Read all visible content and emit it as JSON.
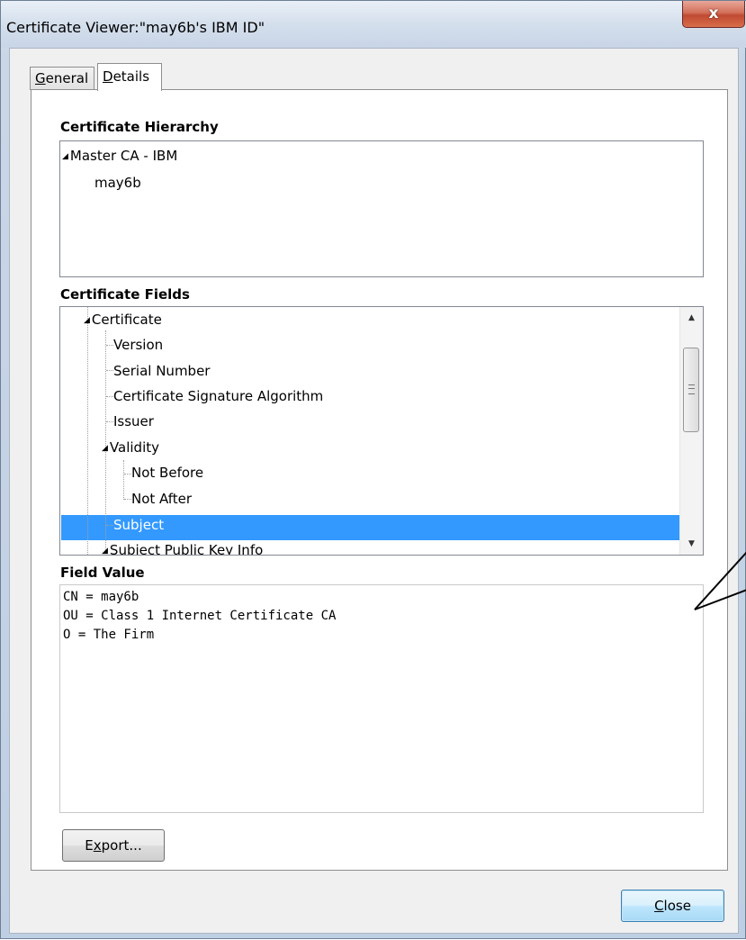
{
  "window": {
    "title": "Certificate Viewer:\"may6b's IBM ID\"",
    "close_label": "x"
  },
  "tabs": [
    {
      "label_u": "G",
      "label_rest": "eneral"
    },
    {
      "label_u": "D",
      "label_rest": "etails"
    }
  ],
  "hierarchy": {
    "label": "Certificate Hierarchy",
    "items": [
      "Master CA - IBM",
      "may6b"
    ]
  },
  "fields": {
    "label": "Certificate Fields",
    "items": [
      "Certificate",
      "Version",
      "Serial Number",
      "Certificate Signature Algorithm",
      "Issuer",
      "Validity",
      "Not Before",
      "Not After",
      "Subject",
      "Subject Public Key Info"
    ],
    "selected": "Subject"
  },
  "value": {
    "label": "Field Value",
    "lines": [
      "CN = may6b",
      "OU = Class 1 Internet Certificate CA",
      "O = The Firm"
    ]
  },
  "buttons": {
    "export_u": "x",
    "export_pre": "E",
    "export_rest": "port...",
    "close_u": "C",
    "close_rest": "lose"
  },
  "icons": {
    "expand": "triangle-down-icon",
    "scroll_up": "scroll-up-icon",
    "scroll_down": "scroll-down-icon",
    "grip": "scroll-grip-icon"
  },
  "colors": {
    "selection": "#3399ff",
    "close_button": "#c04a32"
  }
}
